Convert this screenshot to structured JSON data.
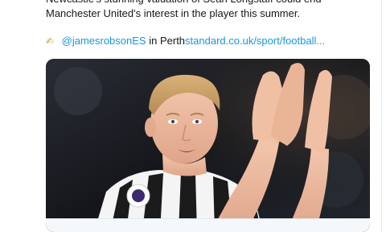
{
  "tweet": {
    "text_line1": "Newcastle's stunning valuation of Sean Longstaff could end",
    "text_line2": "Manchester United's interest in the player this summer.",
    "attribution_emoji": "✍",
    "author_handle": "@jamesrobsonES",
    "attribution_in": "in",
    "source_prefix": "Perth",
    "source_link": "standard.co.uk/sport/football..."
  },
  "media": {
    "image_description_icon": "photo-player-applauding",
    "kit_color_primary": "#1b1b1b",
    "kit_color_secondary": "#ffffff"
  }
}
